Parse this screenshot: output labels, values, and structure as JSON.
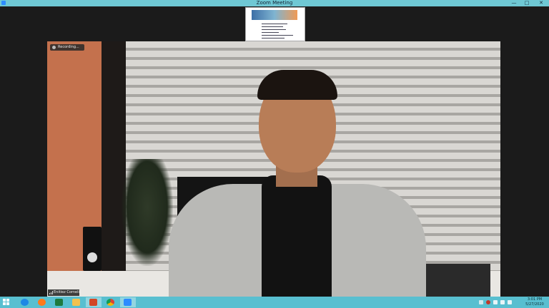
{
  "window": {
    "title": "Zoom Meeting",
    "minimize_glyph": "—",
    "maximize_glyph": "□",
    "close_glyph": "✕"
  },
  "meeting": {
    "recording_label": "Recording...",
    "participant_name": "Enitiez Cornelis",
    "shared_screen_thumbnail": "shared-slide"
  },
  "taskbar": {
    "items": [
      "start-button",
      "internet-explorer-icon",
      "firefox-icon",
      "excel-icon",
      "file-explorer-icon",
      "powerpoint-icon",
      "chrome-icon",
      "zoom-icon"
    ],
    "clock_time": "3:01 PM",
    "clock_date": "5/27/2020"
  },
  "colors": {
    "titlebar": "#6fc8d4",
    "taskbar": "#58bfd0",
    "zoom_blue": "#2d8cff"
  }
}
